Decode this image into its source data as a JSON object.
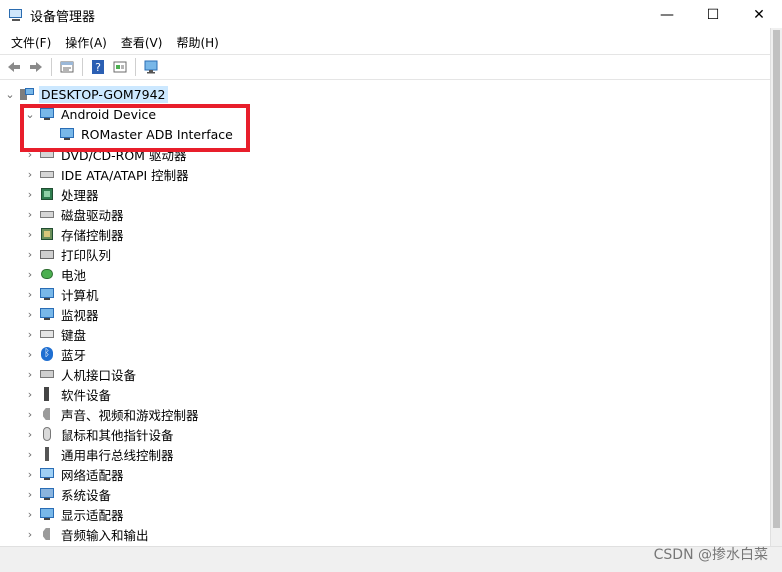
{
  "window": {
    "title": "设备管理器",
    "minimize_glyph": "—",
    "maximize_glyph": "☐",
    "close_glyph": "✕"
  },
  "menu": [
    {
      "label": "文件(F)"
    },
    {
      "label": "操作(A)"
    },
    {
      "label": "查看(V)"
    },
    {
      "label": "帮助(H)"
    }
  ],
  "toolbar": {
    "back_icon": "back-arrow-icon",
    "forward_icon": "forward-arrow-icon",
    "properties_icon": "properties-icon",
    "help_icon": "help-icon",
    "view_icon": "view-icon",
    "scan_icon": "scan-hardware-icon"
  },
  "tree": {
    "root_label": "DESKTOP-GOM7942",
    "items": [
      {
        "label": "Android Device",
        "expanded": true,
        "icon": "monitor-icon"
      },
      {
        "label": "ROMaster ADB Interface",
        "child": true,
        "icon": "monitor-icon"
      },
      {
        "label": "DVD/CD-ROM 驱动器",
        "icon": "drive-icon"
      },
      {
        "label": "IDE ATA/ATAPI 控制器",
        "icon": "drive-icon"
      },
      {
        "label": "处理器",
        "icon": "chip-icon"
      },
      {
        "label": "磁盘驱动器",
        "icon": "drive-icon"
      },
      {
        "label": "存储控制器",
        "icon": "storage-icon"
      },
      {
        "label": "打印队列",
        "icon": "printer-icon"
      },
      {
        "label": "电池",
        "icon": "battery-icon"
      },
      {
        "label": "计算机",
        "icon": "computer-icon"
      },
      {
        "label": "监视器",
        "icon": "monitor-icon"
      },
      {
        "label": "键盘",
        "icon": "keyboard-icon"
      },
      {
        "label": "蓝牙",
        "icon": "bluetooth-icon"
      },
      {
        "label": "人机接口设备",
        "icon": "hid-icon"
      },
      {
        "label": "软件设备",
        "icon": "software-icon"
      },
      {
        "label": "声音、视频和游戏控制器",
        "icon": "speaker-icon"
      },
      {
        "label": "鼠标和其他指针设备",
        "icon": "mouse-icon"
      },
      {
        "label": "通用串行总线控制器",
        "icon": "usb-icon"
      },
      {
        "label": "网络适配器",
        "icon": "network-icon"
      },
      {
        "label": "系统设备",
        "icon": "system-icon"
      },
      {
        "label": "显示适配器",
        "icon": "display-icon"
      },
      {
        "label": "音频输入和输出",
        "icon": "speaker-icon"
      }
    ]
  },
  "watermark": "CSDN @掺水白菜",
  "colors": {
    "highlight": "#e81e2b",
    "selection": "#cce8ff"
  }
}
